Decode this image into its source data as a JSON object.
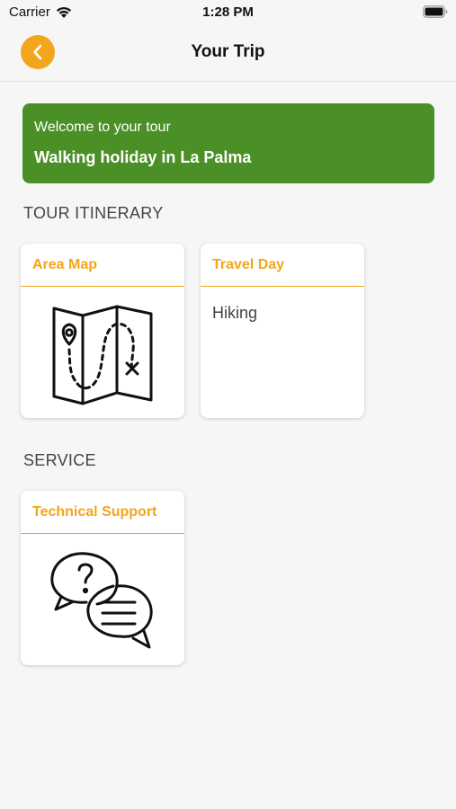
{
  "status_bar": {
    "carrier": "Carrier",
    "time": "1:28 PM"
  },
  "nav": {
    "title": "Your Trip",
    "back_icon": "chevron-left-icon",
    "accent_color": "#f3a51b"
  },
  "welcome": {
    "subtitle": "Welcome to your tour",
    "title": "Walking holiday in La Palma",
    "background_color": "#4a9027"
  },
  "itinerary": {
    "heading": "TOUR ITINERARY",
    "cards": [
      {
        "title": "Area Map",
        "icon": "map-icon"
      },
      {
        "title": "Travel Day",
        "text": "Hiking"
      }
    ]
  },
  "service": {
    "heading": "SERVICE",
    "cards": [
      {
        "title": "Technical Support",
        "icon": "support-chat-icon"
      }
    ]
  }
}
